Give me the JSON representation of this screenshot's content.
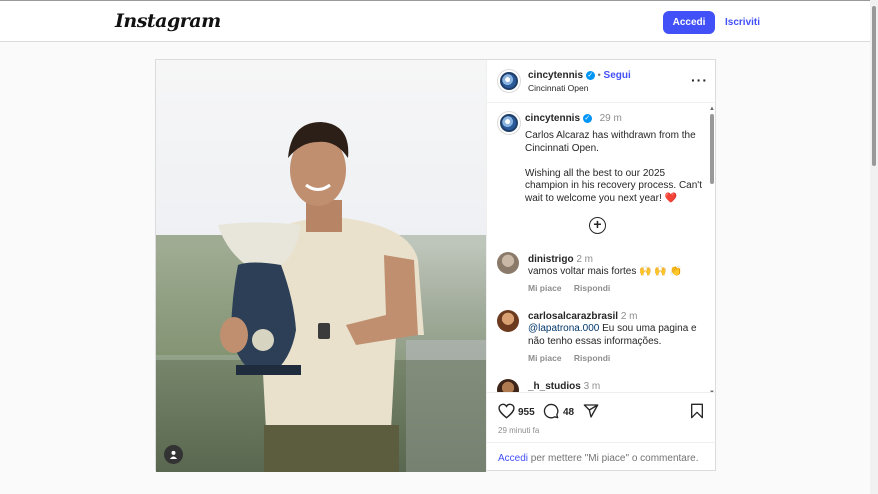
{
  "header": {
    "logo_text": "Instagram",
    "login_label": "Accedi",
    "signup_label": "Iscriviti"
  },
  "post": {
    "author": {
      "username": "cincytennis",
      "follow_label": "Segui",
      "separator": "•",
      "location": "Cincinnati Open"
    },
    "caption": {
      "username": "cincytennis",
      "time": "29 m",
      "text": "Carlos Alcaraz has withdrawn from the Cincinnati Open.\n\nWishing all the best to our 2025 champion in his recovery process. Can't wait to welcome you next year! ❤️"
    },
    "comments": [
      {
        "username": "dinistrigo",
        "time": "2 m",
        "text": "vamos voltar mais fortes 🙌 🙌 👏",
        "like_label": "Mi piace",
        "reply_label": "Rispondi"
      },
      {
        "username": "carlosalcarazbrasil",
        "time": "2 m",
        "mention": "@lapatrona.000",
        "text": " Eu sou uma pagina e não tenho essas informações.",
        "like_label": "Mi piace",
        "reply_label": "Rispondi"
      },
      {
        "username": "_h_studios",
        "time": "3 m"
      }
    ],
    "stats": {
      "likes": "955",
      "comments": "48"
    },
    "posted_ago": "29 minuti fa",
    "login_prompt": {
      "link": "Accedi",
      "text": " per mettere \"Mi piace\" o commentare."
    }
  },
  "colors": {
    "accent": "#4150f7",
    "verified": "#0095f6",
    "heart": "#ed4956"
  },
  "icons": [
    "user-tag-icon",
    "verified-icon",
    "more-options-icon",
    "add-icon",
    "heart-icon",
    "comment-icon",
    "share-icon",
    "bookmark-icon"
  ]
}
